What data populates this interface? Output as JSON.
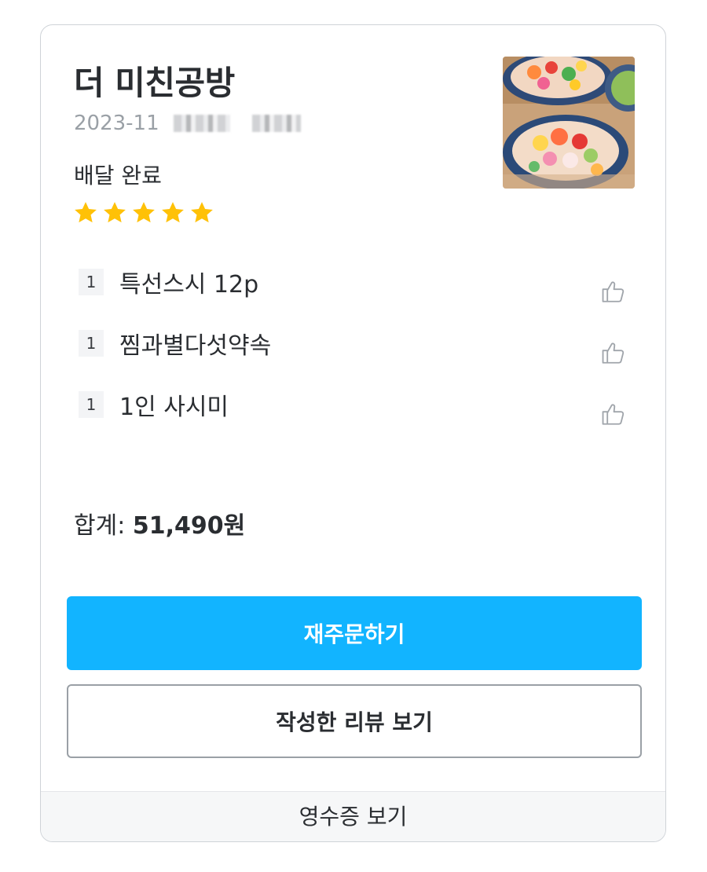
{
  "order": {
    "store_name": "더 미친공방",
    "date_prefix": "2023-11",
    "status": "배달 완료",
    "rating": 5,
    "rating_max": 5,
    "star_color": "#ffc107"
  },
  "items": [
    {
      "qty": "1",
      "name": "특선스시 12p",
      "like_icon": "thumbs-up-outline"
    },
    {
      "qty": "1",
      "name": "찜과별다섯약속",
      "like_icon": "thumbs-up-outline"
    },
    {
      "qty": "1",
      "name": "1인 사시미",
      "like_icon": "thumbs-up-outline"
    }
  ],
  "total": {
    "label": "합계:",
    "amount": "51,490원"
  },
  "actions": {
    "reorder_label": "재주문하기",
    "review_label": "작성한 리뷰 보기",
    "receipt_label": "영수증 보기",
    "accent_color": "#12b4ff"
  }
}
